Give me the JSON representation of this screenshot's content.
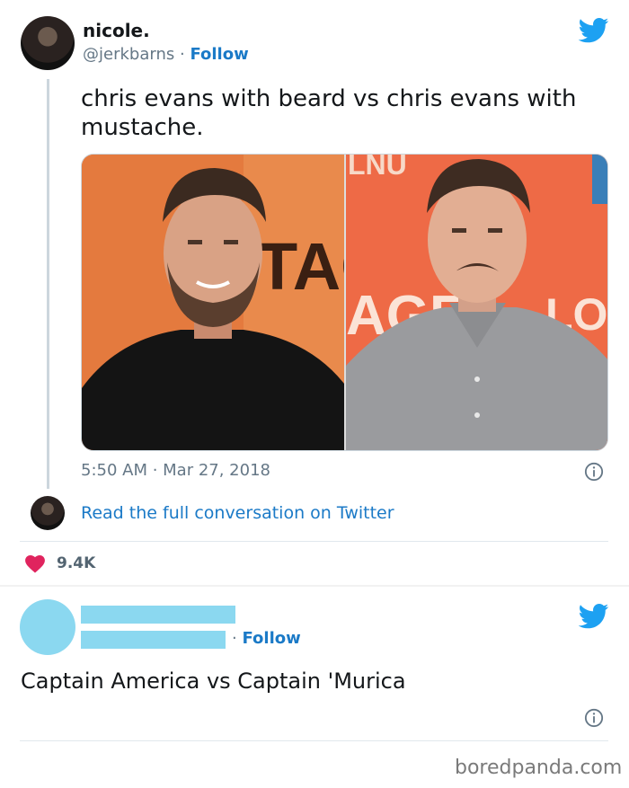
{
  "tweet1": {
    "display_name": "nicole.",
    "handle": "@jerkbarns",
    "separator": "·",
    "follow_label": "Follow",
    "text": "chris evans with beard vs chris evans with mustache.",
    "media": {
      "left_background_text": "TAG",
      "right_background_text_top": "LNU",
      "right_background_text_mid": "AGE",
      "right_background_text_side": "LOBE"
    },
    "timestamp": "5:50 AM · Mar 27, 2018",
    "read_full_label": "Read the full conversation on Twitter",
    "likes": "9.4K",
    "icons": [
      "twitter-bird-icon",
      "info-icon",
      "heart-icon"
    ],
    "colors": {
      "link": "#1b7ac7",
      "heart": "#e0245e",
      "twitter_blue": "#1da1f2"
    }
  },
  "tweet2": {
    "follow_label": "Follow",
    "separator": "·",
    "text": "Captain America vs Captain 'Murica",
    "colors": {
      "redaction": "#8bd8f0"
    }
  },
  "watermark": "boredpanda.com"
}
